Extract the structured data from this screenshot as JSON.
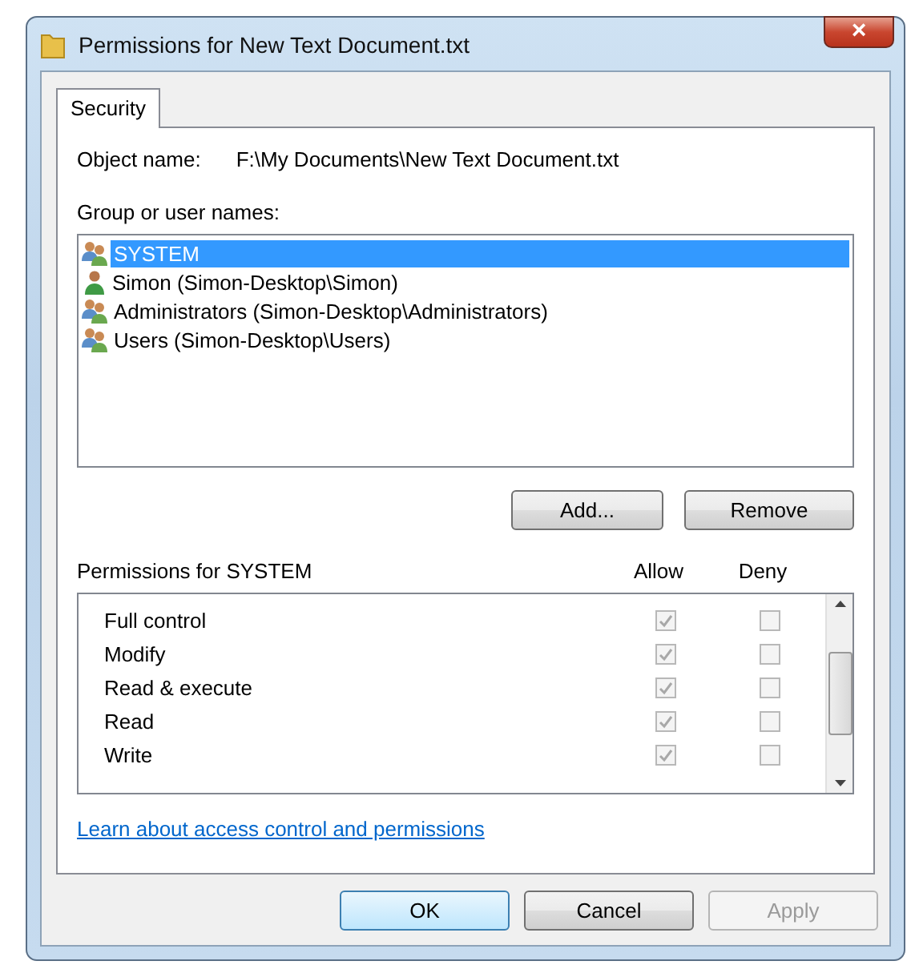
{
  "window": {
    "title": "Permissions for New Text Document.txt",
    "close": "×"
  },
  "tabs": [
    {
      "label": "Security",
      "selected": true
    }
  ],
  "object_name": {
    "label": "Object name:",
    "value": "F:\\My Documents\\New Text Document.txt"
  },
  "groups_label": "Group or user names:",
  "principals": [
    {
      "name": "SYSTEM",
      "kind": "group",
      "selected": true
    },
    {
      "name": "Simon (Simon-Desktop\\Simon)",
      "kind": "user",
      "selected": false
    },
    {
      "name": "Administrators (Simon-Desktop\\Administrators)",
      "kind": "group",
      "selected": false
    },
    {
      "name": "Users (Simon-Desktop\\Users)",
      "kind": "group",
      "selected": false
    }
  ],
  "principal_buttons": [
    {
      "label": "Add...",
      "disabled": false
    },
    {
      "label": "Remove",
      "disabled": false
    }
  ],
  "permissions": {
    "title": "Permissions for SYSTEM",
    "allow_header": "Allow",
    "deny_header": "Deny",
    "rows": [
      {
        "name": "Full control",
        "allow": true,
        "deny": false,
        "disabled": true
      },
      {
        "name": "Modify",
        "allow": true,
        "deny": false,
        "disabled": true
      },
      {
        "name": "Read & execute",
        "allow": true,
        "deny": false,
        "disabled": true
      },
      {
        "name": "Read",
        "allow": true,
        "deny": false,
        "disabled": true
      },
      {
        "name": "Write",
        "allow": true,
        "deny": false,
        "disabled": true
      }
    ]
  },
  "link": "Learn about access control and permissions",
  "buttons": [
    {
      "label": "OK",
      "default": true,
      "disabled": false
    },
    {
      "label": "Cancel",
      "default": false,
      "disabled": false
    },
    {
      "label": "Apply",
      "default": false,
      "disabled": true
    }
  ]
}
